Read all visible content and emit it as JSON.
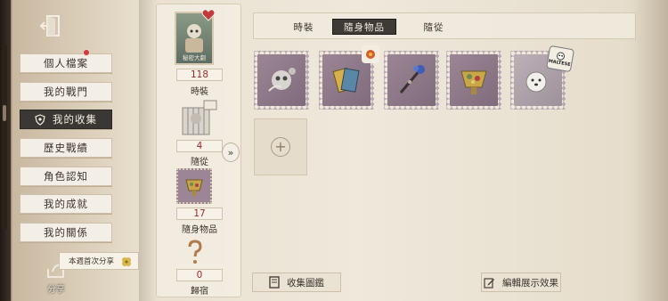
{
  "menu": {
    "items": [
      {
        "label": "個人檔案",
        "active": false,
        "badge": true
      },
      {
        "label": "我的戰門",
        "active": false,
        "badge": false
      },
      {
        "label": "我的收集",
        "active": true,
        "badge": false
      },
      {
        "label": "歷史戰績",
        "active": false,
        "badge": false
      },
      {
        "label": "角色認知",
        "active": false,
        "badge": false
      },
      {
        "label": "我的成就",
        "active": false,
        "badge": false
      },
      {
        "label": "我的關係",
        "active": false,
        "badge": false
      }
    ]
  },
  "share": {
    "tooltip": "本週首次分享",
    "label": "分享"
  },
  "summary": {
    "costume_card_label": "秘密大劇",
    "costume_count": "118",
    "costume_label": "時裝",
    "pet_count": "4",
    "pet_label": "隨從",
    "accessory_count": "17",
    "accessory_label": "隨身物品",
    "home_count": "0",
    "home_label": "歸宿"
  },
  "tabs": [
    {
      "label": "時裝",
      "active": false
    },
    {
      "label": "隨身物品",
      "active": true
    },
    {
      "label": "隨從",
      "active": false
    }
  ],
  "items": [
    {
      "name": "silver-skull-flower-item"
    },
    {
      "name": "tarot-cards-item"
    },
    {
      "name": "blue-staff-item"
    },
    {
      "name": "gold-cup-item"
    },
    {
      "name": "maltese-plush-item",
      "tag": "MALTESE"
    }
  ],
  "buttons": {
    "catalog": "收集圖鑑",
    "edit": "編輯展示效果"
  },
  "colors": {
    "active_bg": "#3a3734",
    "count_text": "#a02a2a",
    "badge": "#d23b3b"
  }
}
